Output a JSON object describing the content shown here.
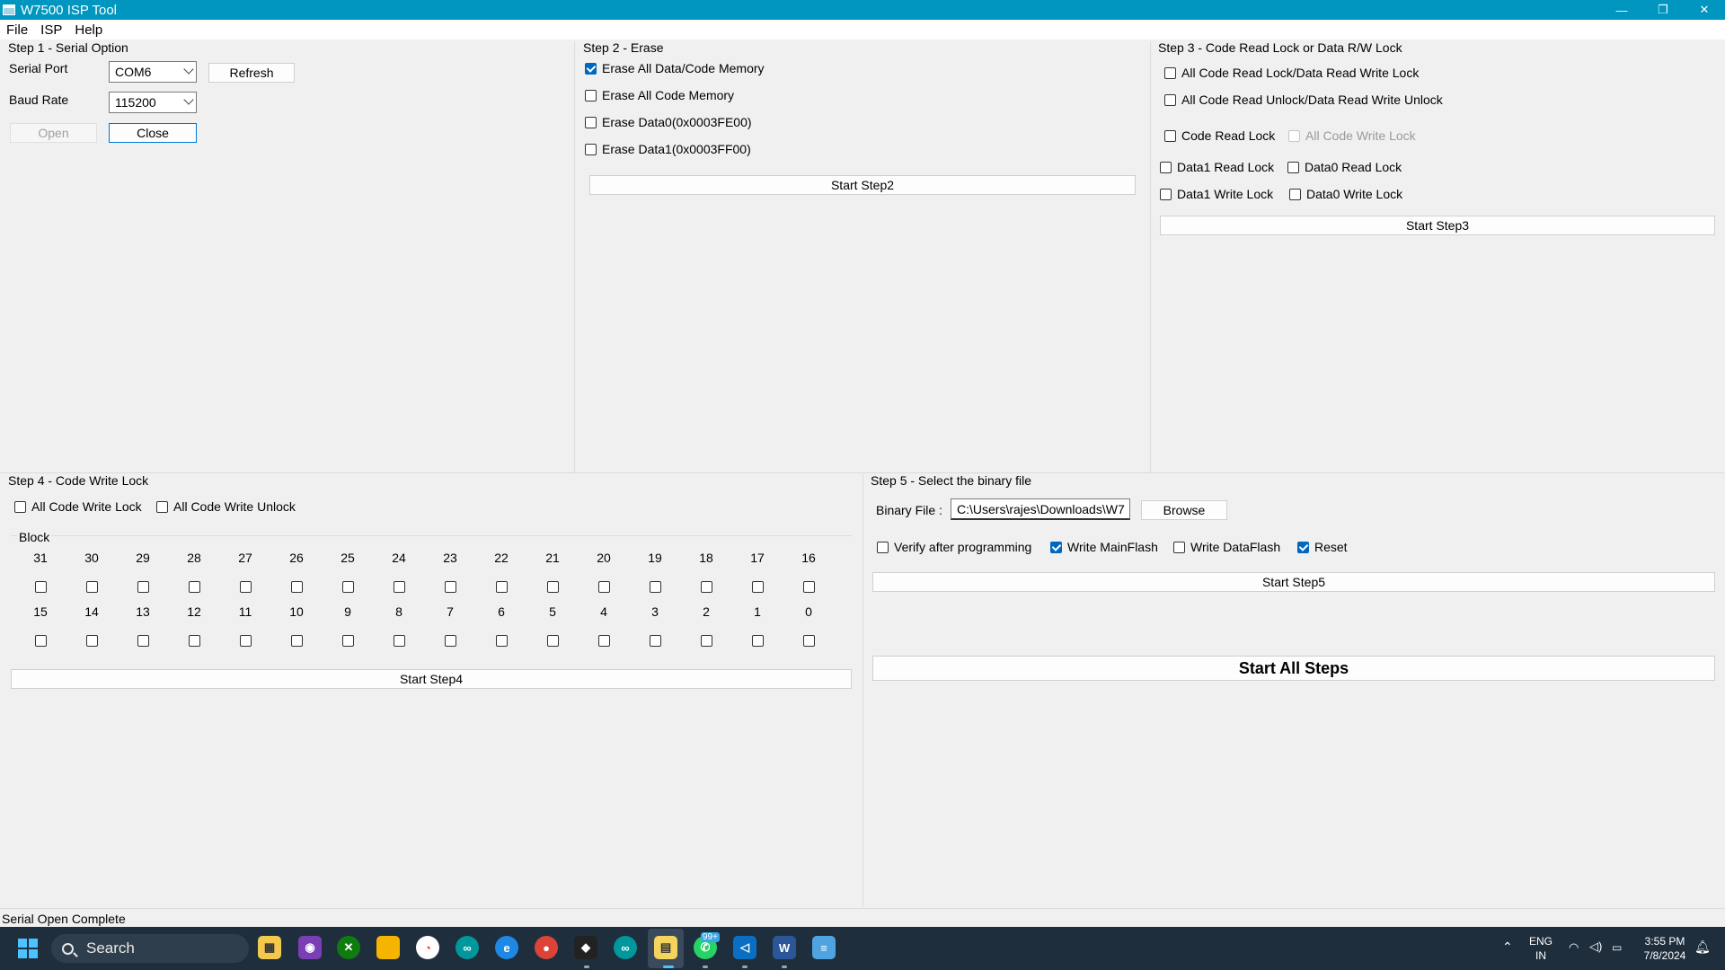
{
  "window": {
    "title": "W7500 ISP Tool",
    "controls": [
      "—",
      "❐",
      "✕"
    ]
  },
  "menu": [
    "File",
    "ISP",
    "Help"
  ],
  "step1": {
    "title": "Step 1 - Serial Option",
    "serial_port_label": "Serial Port",
    "serial_port_value": "COM6",
    "refresh_label": "Refresh",
    "baud_rate_label": "Baud Rate",
    "baud_rate_value": "115200",
    "open_label": "Open",
    "close_label": "Close"
  },
  "step2": {
    "title": "Step 2 - Erase",
    "options": [
      {
        "label": "Erase All Data/Code Memory",
        "checked": true
      },
      {
        "label": "Erase All Code Memory",
        "checked": false
      },
      {
        "label": "Erase Data0(0x0003FE00)",
        "checked": false
      },
      {
        "label": "Erase Data1(0x0003FF00)",
        "checked": false
      }
    ],
    "start_label": "Start Step2"
  },
  "step3": {
    "title": "Step 3 - Code Read Lock or Data R/W Lock",
    "all_lock": "All Code Read Lock/Data Read Write Lock",
    "all_unlock": "All Code Read Unlock/Data Read Write Unlock",
    "code_read_lock": "Code Read Lock",
    "all_code_write_lock": "All Code Write Lock",
    "data1_read_lock": "Data1 Read Lock",
    "data0_read_lock": "Data0 Read Lock",
    "data1_write_lock": "Data1 Write Lock",
    "data0_write_lock": "Data0 Write Lock",
    "start_label": "Start Step3"
  },
  "step4": {
    "title": "Step 4 - Code Write Lock",
    "all_lock": "All Code Write Lock",
    "all_unlock": "All Code Write Unlock",
    "block_label": "Block",
    "row1": [
      "31",
      "30",
      "29",
      "28",
      "27",
      "26",
      "25",
      "24",
      "23",
      "22",
      "21",
      "20",
      "19",
      "18",
      "17",
      "16"
    ],
    "row2": [
      "15",
      "14",
      "13",
      "12",
      "11",
      "10",
      "9",
      "8",
      "7",
      "6",
      "5",
      "4",
      "3",
      "2",
      "1",
      "0"
    ],
    "start_label": "Start Step4"
  },
  "step5": {
    "title": "Step 5 - Select the binary file",
    "binary_label": "Binary File :",
    "binary_value": "C:\\Users\\rajes\\Downloads\\W7",
    "browse_label": "Browse",
    "verify_label": "Verify after programming",
    "verify_checked": false,
    "write_main_label": "Write MainFlash",
    "write_main_checked": true,
    "write_data_label": "Write DataFlash",
    "write_data_checked": false,
    "reset_label": "Reset",
    "reset_checked": true,
    "start_label": "Start Step5",
    "start_all_label": "Start All Steps"
  },
  "status": "Serial Open Complete",
  "taskbar": {
    "search_placeholder": "Search",
    "badge": "99+",
    "lang_line1": "ENG",
    "lang_line2": "IN",
    "time": "3:55 PM",
    "date": "7/8/2024"
  }
}
